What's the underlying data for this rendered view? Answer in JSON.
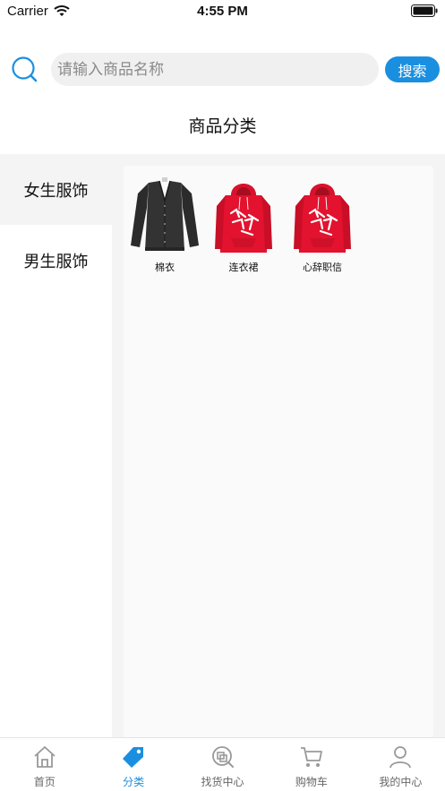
{
  "status_bar": {
    "carrier": "Carrier",
    "time": "4:55 PM"
  },
  "search": {
    "placeholder": "请输入商品名称",
    "button_label": "搜索"
  },
  "page_title": "商品分类",
  "sidebar": {
    "items": [
      {
        "label": "女生服饰",
        "active": true
      },
      {
        "label": "男生服饰",
        "active": false
      }
    ]
  },
  "products": [
    {
      "name": "棉衣",
      "image": "black-cardigan"
    },
    {
      "name": "连衣裙",
      "image": "red-hoodie"
    },
    {
      "name": "心辞职信",
      "image": "red-hoodie"
    }
  ],
  "tab_bar": {
    "tabs": [
      {
        "label": "首页",
        "icon": "home-icon",
        "active": false
      },
      {
        "label": "分类",
        "icon": "tag-icon",
        "active": true
      },
      {
        "label": "找货中心",
        "icon": "find-goods-icon",
        "active": false
      },
      {
        "label": "购物车",
        "icon": "cart-icon",
        "active": false
      },
      {
        "label": "我的中心",
        "icon": "person-icon",
        "active": false
      }
    ]
  },
  "colors": {
    "accent": "#1a8fe0",
    "tab_inactive": "#666666",
    "panel_bg": "#f4f4f4"
  }
}
